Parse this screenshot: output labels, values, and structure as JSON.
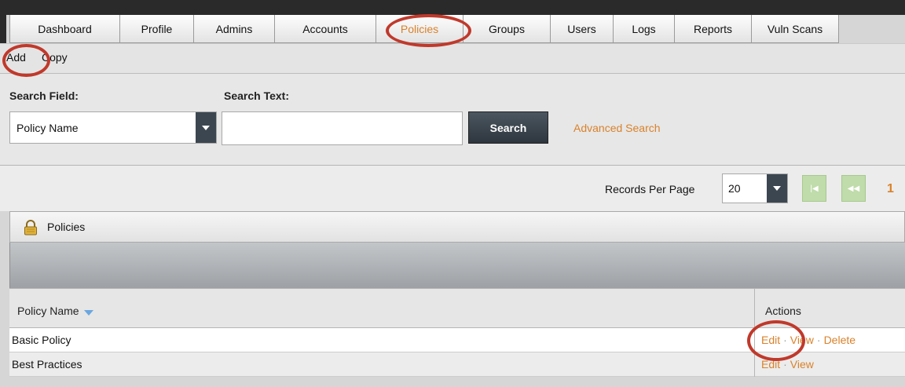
{
  "tabs": [
    {
      "label": "Dashboard"
    },
    {
      "label": "Profile"
    },
    {
      "label": "Admins"
    },
    {
      "label": "Accounts"
    },
    {
      "label": "Policies",
      "active": true
    },
    {
      "label": "Groups"
    },
    {
      "label": "Users"
    },
    {
      "label": "Logs"
    },
    {
      "label": "Reports"
    },
    {
      "label": "Vuln Scans"
    }
  ],
  "actions": {
    "add": "Add",
    "copy": "Copy"
  },
  "search": {
    "field_label": "Search Field:",
    "text_label": "Search Text:",
    "field_value": "Policy Name",
    "text_value": "",
    "button": "Search",
    "advanced": "Advanced Search"
  },
  "records": {
    "label": "Records Per Page",
    "value": "20",
    "page": "1"
  },
  "panel": {
    "title": "Policies",
    "icon": "lock-icon"
  },
  "table": {
    "columns": [
      "Policy Name",
      "Actions"
    ],
    "rows": [
      {
        "name": "Basic Policy",
        "actions": [
          "Edit",
          "View",
          "Delete"
        ]
      },
      {
        "name": "Best Practices",
        "actions": [
          "Edit",
          "View"
        ]
      }
    ]
  },
  "colors": {
    "accent": "#d9822b",
    "annotation": "#c0392b",
    "pager": "#bfdcaa"
  }
}
